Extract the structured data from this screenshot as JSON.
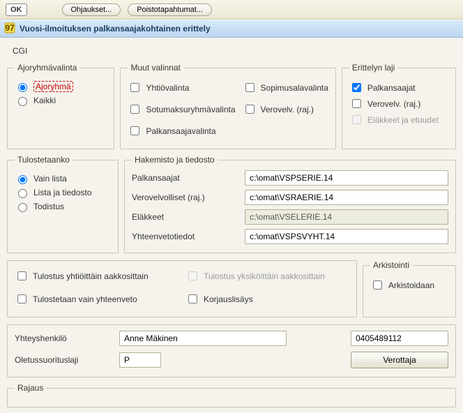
{
  "toolbar": {
    "ok": "OK",
    "btn1": "Ohjaukset...",
    "btn2": "Poistotapahtumat..."
  },
  "title": "Vuosi-ilmoituksen palkansaajakohtainen erittely",
  "client": "CGI",
  "ajoryhma": {
    "legend": "Ajoryhmävalinta",
    "opt1": "Ajoryhmä",
    "opt2": "Kaikki"
  },
  "muut": {
    "legend": "Muut valinnat",
    "yhtiovalinta": "Yhtiövalinta",
    "sopimusala": "Sopimusalavalinta",
    "sotumaksu": "Sotumaksuryhmävalinta",
    "verovelv": "Verovelv. (raj.)",
    "palkansaajavalinta": "Palkansaajavalinta"
  },
  "erittely": {
    "legend": "Erittelyn laji",
    "palkansaajat": "Palkansaajat",
    "verovelv": "Verovelv. (raj.)",
    "elakkeet": "Eläkkeet ja etuudet"
  },
  "tulostetaanko": {
    "legend": "Tulostetaanko",
    "opt1": "Vain lista",
    "opt2": "Lista ja tiedosto",
    "opt3": "Todistus"
  },
  "hakemisto": {
    "legend": "Hakemisto ja tiedosto",
    "rows": [
      {
        "label": "Palkansaajat",
        "value": "c:\\omat\\VSPSERIE.14",
        "readonly": false
      },
      {
        "label": "Verovelvolliset (raj.)",
        "value": "c:\\omat\\VSRAERIE.14",
        "readonly": false
      },
      {
        "label": "Eläkkeet",
        "value": "c:\\omat\\VSELERIE.14",
        "readonly": true
      },
      {
        "label": "Yhteenvetotiedot",
        "value": "c:\\omat\\VSPSVYHT.14",
        "readonly": false
      }
    ]
  },
  "middle": {
    "tulostus_yhtio": "Tulostus yhtiöittäin aakkosittain",
    "tulostus_yksikko": "Tulostus yksiköittäin aakkosittain",
    "tulostetaan_vain": "Tulostetaan vain yhteenveto",
    "korjauslisays": "Korjauslisäys"
  },
  "arkistointi": {
    "legend": "Arkistointi",
    "label": "Arkistoidaan"
  },
  "form": {
    "yhteyshenkilo_label": "Yhteyshenkilö",
    "yhteyshenkilo_value": "Anne Mäkinen",
    "puhelin_value": "0405489112",
    "oletussuoritus_label": "Oletussuorituslaji",
    "oletussuoritus_value": "P",
    "verottaja_btn": "Verottaja"
  },
  "rajaus": {
    "legend": "Rajaus"
  }
}
